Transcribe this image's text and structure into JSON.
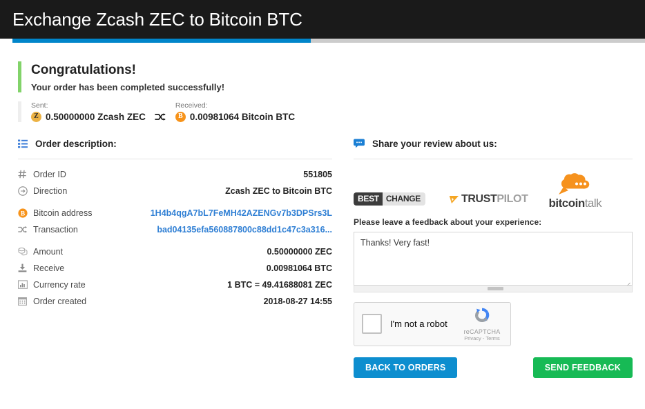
{
  "header": {
    "title": "Exchange Zcash ZEC to Bitcoin BTC"
  },
  "progress": {
    "percent": 47
  },
  "status": {
    "heading": "Congratulations!",
    "message": "Your order has been completed successfully!",
    "sent_label": "Sent:",
    "sent_value": "0.50000000 Zcash ZEC",
    "sent_coin_glyph": "Z",
    "received_label": "Received:",
    "received_value": "0.00981064 Bitcoin BTC",
    "received_coin_glyph": "B",
    "swap_icon": "shuffle-icon"
  },
  "order": {
    "heading": "Order description:",
    "heading_icon": "list-icon",
    "rows": [
      {
        "icon": "hash-icon",
        "label": "Order ID",
        "value": "551805",
        "link": false,
        "gap": false
      },
      {
        "icon": "arrow-circle-icon",
        "label": "Direction",
        "value": "Zcash ZEC to Bitcoin BTC",
        "link": false,
        "gap": false
      },
      {
        "icon": "bitcoin-icon",
        "label": "Bitcoin address",
        "value": "1H4b4qgA7bL7FeMH42AZENGv7b3DPSrs3L",
        "link": true,
        "gap": true
      },
      {
        "icon": "shuffle-icon",
        "label": "Transaction",
        "value": "bad04135efa560887800c88dd1c47c3a316...",
        "link": true,
        "gap": false
      },
      {
        "icon": "coins-icon",
        "label": "Amount",
        "value": "0.50000000 ZEC",
        "link": false,
        "gap": true
      },
      {
        "icon": "download-icon",
        "label": "Receive",
        "value": "0.00981064 BTC",
        "link": false,
        "gap": false
      },
      {
        "icon": "chart-icon",
        "label": "Currency rate",
        "value": "1 BTC = 49.41688081 ZEC",
        "link": false,
        "gap": false
      },
      {
        "icon": "calendar-icon",
        "label": "Order created",
        "value": "2018-08-27 14:55",
        "link": false,
        "gap": false
      }
    ]
  },
  "review": {
    "heading": "Share your review about us:",
    "heading_icon": "speech-bubble-icon",
    "logos": {
      "bestchange_a": "BEST",
      "bestchange_b": "CHANGE",
      "trustpilot_a": "TRUST",
      "trustpilot_b": "PILOT",
      "bitcointalk_a": "bitcoin",
      "bitcointalk_b": "talk"
    },
    "feedback_label": "Please leave a feedback about your experience:",
    "feedback_value": "Thanks! Very fast!",
    "feedback_placeholder": ""
  },
  "recaptcha": {
    "text": "I'm not a robot",
    "brand": "reCAPTCHA",
    "links": "Privacy - Terms"
  },
  "buttons": {
    "back": "BACK TO ORDERS",
    "send": "SEND FEEDBACK"
  },
  "colors": {
    "accent_blue": "#0085ca",
    "success_green": "#82d36a",
    "link_blue": "#2f7fd4",
    "btc_orange": "#f7931a",
    "zec_gold": "#ecb244",
    "send_green": "#17ba55",
    "back_blue": "#0d8ecf",
    "header_black": "#1a1a1a"
  }
}
